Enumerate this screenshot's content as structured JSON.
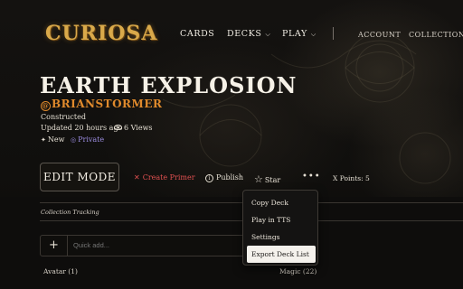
{
  "header": {
    "logo": "CURIOSA",
    "nav": {
      "cards": "CARDS",
      "decks": "DECKS",
      "play": "PLAY"
    },
    "account": "ACCOUNT",
    "collection": "COLLECTION"
  },
  "deck": {
    "title": "EARTH EXPLOSION",
    "author": "BRIANSTORMER",
    "format": "Constructed",
    "updated": "Updated 20 hours ago",
    "views": "6 Views",
    "new_badge": "New",
    "private_badge": "Private"
  },
  "actions": {
    "edit_mode": "EDIT MODE",
    "create_primer": "Create Primer",
    "publish": "Publish",
    "star": "Star",
    "more": "•••",
    "x_points": "X Points: 5"
  },
  "collection_tracking": "Collection Tracking",
  "quick_add": {
    "placeholder": "Quick add..."
  },
  "sections": {
    "avatar": "Avatar (1)",
    "magic": "Magic (22)"
  },
  "menu": {
    "items": [
      "Copy Deck",
      "Play in TTS",
      "Settings",
      "Export Deck List"
    ],
    "active_index": 3
  },
  "colors": {
    "accent": "#e08a2c",
    "logo": "#d9a94a",
    "primer": "#e05050",
    "private": "#9b8de0"
  }
}
